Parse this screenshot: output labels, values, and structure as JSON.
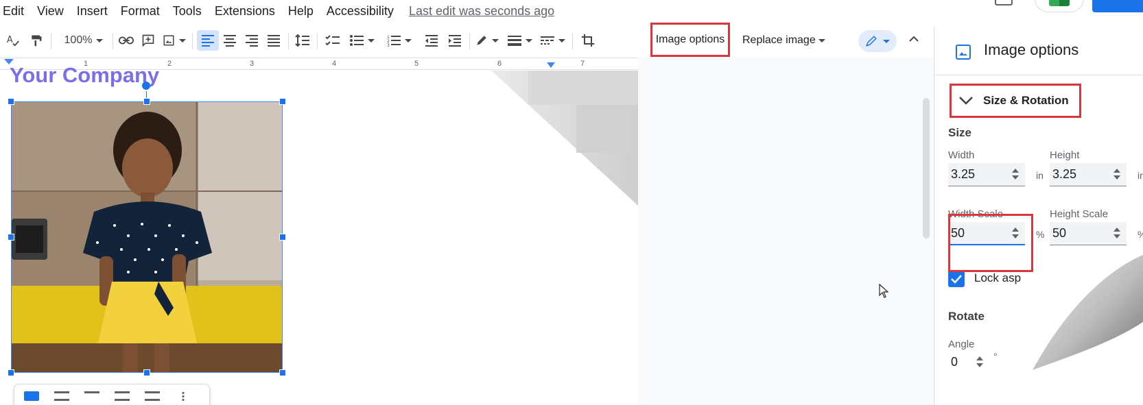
{
  "menu": {
    "items": [
      "Edit",
      "View",
      "Insert",
      "Format",
      "Tools",
      "Extensions",
      "Help",
      "Accessibility"
    ],
    "last_edit": "Last edit was seconds ago"
  },
  "toolbar": {
    "zoom": "100%",
    "image_options_label": "Image options",
    "replace_image_label": "Replace image"
  },
  "ruler": {
    "numbers": [
      "1",
      "2",
      "3",
      "4",
      "5",
      "6",
      "7"
    ]
  },
  "document": {
    "company": "Your Company",
    "image_description": "photo-of-child-in-polka-dot-top"
  },
  "panel": {
    "title": "Image options",
    "section": "Size & Rotation",
    "size_heading": "Size",
    "width_label": "Width",
    "width_value": "3.25",
    "width_unit": "in",
    "height_label": "Height",
    "height_value": "3.25",
    "height_unit": "in",
    "width_scale_label": "Width Scale",
    "width_scale_value": "50",
    "width_scale_unit": "%",
    "height_scale_label": "Height Scale",
    "height_scale_value": "50",
    "height_scale_unit": "%",
    "lock_label": "Lock asp",
    "rotate_heading": "Rotate",
    "angle_label": "Angle",
    "angle_value": "0",
    "angle_unit": "°"
  },
  "colors": {
    "highlight": "#d9363e",
    "accent": "#1a73e8",
    "company_text": "#7b6fe8"
  }
}
